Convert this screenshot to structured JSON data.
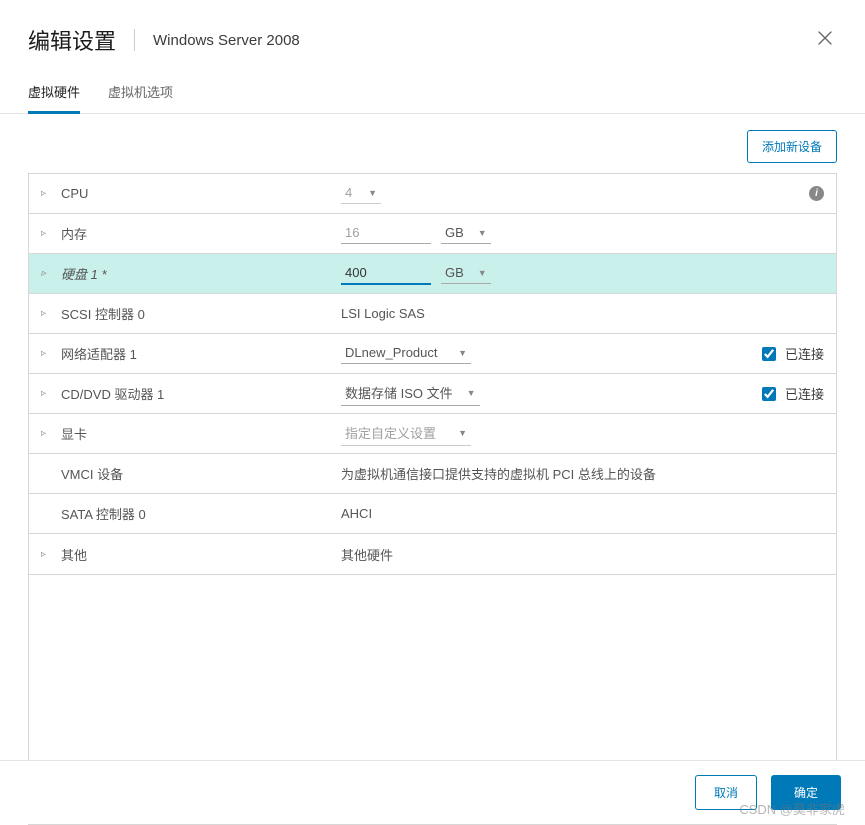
{
  "header": {
    "title": "编辑设置",
    "subtitle": "Windows Server 2008"
  },
  "tabs": {
    "hardware": "虚拟硬件",
    "options": "虚拟机选项"
  },
  "actions": {
    "add_device": "添加新设备",
    "cancel": "取消",
    "ok": "确定"
  },
  "rows": {
    "cpu": {
      "label": "CPU",
      "value": "4"
    },
    "memory": {
      "label": "内存",
      "value": "16",
      "unit": "GB"
    },
    "disk1": {
      "label": "硬盘 1 *",
      "value": "400",
      "unit": "GB"
    },
    "scsi0": {
      "label": "SCSI 控制器 0",
      "value": "LSI Logic SAS"
    },
    "nic1": {
      "label": "网络适配器 1",
      "value": "DLnew_Product",
      "connected": "已连接"
    },
    "cd1": {
      "label": "CD/DVD 驱动器 1",
      "value": "数据存储 ISO 文件",
      "connected": "已连接"
    },
    "video": {
      "label": "显卡",
      "value": "指定自定义设置"
    },
    "vmci": {
      "label": "VMCI 设备",
      "value": "为虚拟机通信接口提供支持的虚拟机 PCI 总线上的设备"
    },
    "sata0": {
      "label": "SATA 控制器 0",
      "value": "AHCI"
    },
    "other": {
      "label": "其他",
      "value": "其他硬件"
    }
  },
  "watermark": "CSDN @莫非家虎"
}
